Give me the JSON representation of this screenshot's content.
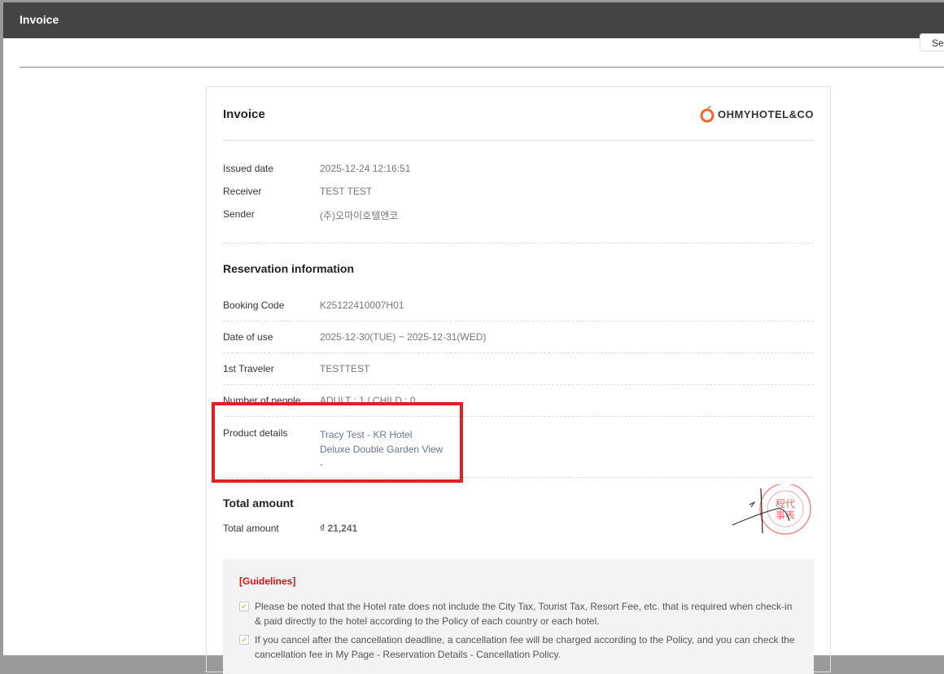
{
  "modal": {
    "title": "Invoice",
    "side_button": "Se"
  },
  "invoice": {
    "title": "Invoice",
    "logo": "OHMYHOTEL&CO",
    "issued": {
      "label": "Issued date",
      "value": "2025-12-24 12:16:51"
    },
    "receiver": {
      "label": "Receiver",
      "value": "TEST TEST"
    },
    "sender": {
      "label": "Sender",
      "value": "(주)오마이호텔앤코"
    },
    "reservation": {
      "title": "Reservation information",
      "booking_code": {
        "label": "Booking Code",
        "value": "K25122410007H01"
      },
      "date_of_use": {
        "label": "Date of use",
        "value": "2025-12-30(TUE) ~ 2025-12-31(WED)"
      },
      "traveler": {
        "label": "1st Traveler",
        "value": "TESTTEST"
      },
      "people": {
        "label": "Number of people",
        "value": "ADULT : 1 / CHILD : 0"
      },
      "product": {
        "label": "Product details",
        "lines": [
          "Tracy Test - KR Hotel",
          "Deluxe Double Garden View",
          "-"
        ]
      }
    },
    "total": {
      "title": "Total amount",
      "label": "Total amount",
      "value": "₫ 21,241"
    },
    "guidelines": {
      "title": "[Guidelines]",
      "items": [
        "Please be noted that the Hotel rate does not include the City Tax, Tourist Tax, Resort Fee, etc. that is required when check-in & paid directly to the hotel according to the Policy of each country or each hotel.",
        "If you cancel after the cancellation deadline, a cancellation fee will be charged according to the Policy, and you can check the cancellation fee in My Page - Reservation Details - Cancellation Policy."
      ]
    }
  },
  "colors": {
    "header": "#444444",
    "highlight": "#e31e24",
    "guidelines_title": "#e01010",
    "check": "#f08a24"
  }
}
